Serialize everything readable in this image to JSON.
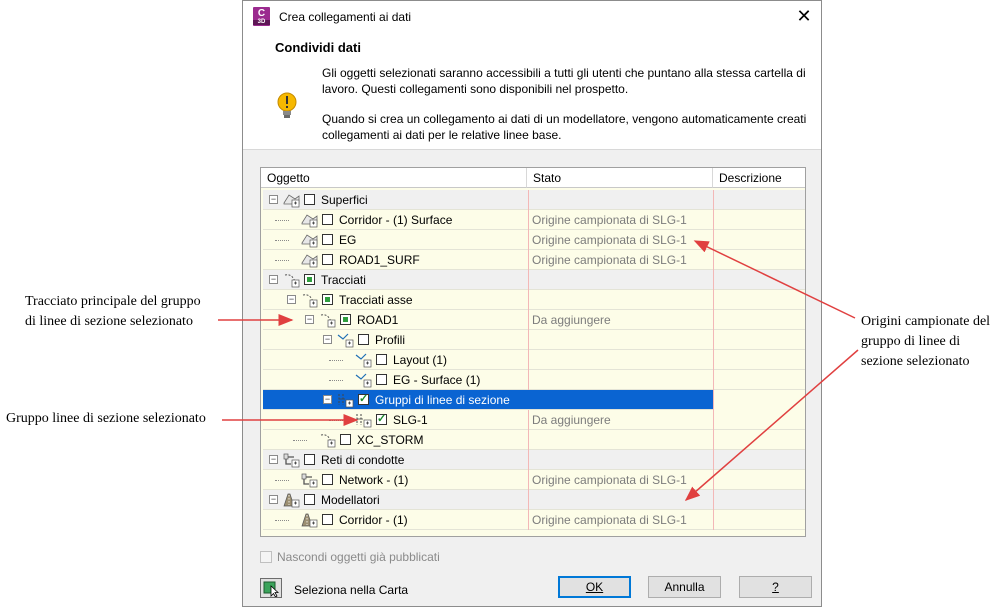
{
  "window": {
    "title": "Crea collegamenti ai dati",
    "app_icon_letter": "C",
    "app_icon_sub": "3D",
    "close_glyph": "✕"
  },
  "header": {
    "title": "Condividi dati",
    "paragraph1": "Gli oggetti selezionati saranno accessibili a tutti gli utenti che puntano alla stessa cartella di lavoro. Questi collegamenti sono disponibili nel prospetto.",
    "paragraph2": "Quando si crea un collegamento ai dati di un modellatore, vengono automaticamente creati collegamenti ai dati per le relative linee base.",
    "icon": "lightbulb-icon"
  },
  "columns": {
    "object": "Oggetto",
    "state": "Stato",
    "description": "Descrizione"
  },
  "tree": {
    "rows": [
      {
        "label": "Superfici",
        "state": "",
        "icon": "surface-icon",
        "check": "none",
        "expander": "−"
      },
      {
        "label": "Corridor - (1) Surface",
        "state": "Origine campionata di SLG-1",
        "icon": "surface-icon",
        "check": "none"
      },
      {
        "label": "EG",
        "state": "Origine campionata di SLG-1",
        "icon": "surface-icon",
        "check": "none"
      },
      {
        "label": "ROAD1_SURF",
        "state": "Origine campionata di SLG-1",
        "icon": "surface-icon",
        "check": "none"
      },
      {
        "label": "Tracciati",
        "state": "",
        "icon": "alignment-icon",
        "check": "partial",
        "expander": "−"
      },
      {
        "label": "Tracciati asse",
        "state": "",
        "icon": "alignment-icon",
        "check": "partial",
        "expander": "−"
      },
      {
        "label": "ROAD1",
        "state": "Da aggiungere",
        "icon": "alignment-icon",
        "check": "partial",
        "expander": "−"
      },
      {
        "label": "Profili",
        "state": "",
        "icon": "profile-icon",
        "check": "none",
        "expander": "−"
      },
      {
        "label": "Layout (1)",
        "state": "",
        "icon": "profile-icon",
        "check": "none"
      },
      {
        "label": "EG - Surface (1)",
        "state": "",
        "icon": "profile-icon",
        "check": "none"
      },
      {
        "label": "Gruppi di linee di sezione",
        "state": "",
        "icon": "sample-line-group-icon",
        "check": "checked",
        "expander": "−"
      },
      {
        "label": "SLG-1",
        "state": "Da aggiungere",
        "icon": "sample-line-group-icon",
        "check": "checked"
      },
      {
        "label": "XC_STORM",
        "state": "",
        "icon": "alignment-icon",
        "check": "none"
      },
      {
        "label": "Reti di condotte",
        "state": "",
        "icon": "pipe-network-icon",
        "check": "none",
        "expander": "−"
      },
      {
        "label": "Network - (1)",
        "state": "Origine campionata di SLG-1",
        "icon": "pipe-network-icon",
        "check": "none"
      },
      {
        "label": "Modellatori",
        "state": "",
        "icon": "corridor-icon",
        "check": "none",
        "expander": "−"
      },
      {
        "label": "Corridor - (1)",
        "state": "Origine campionata di SLG-1",
        "icon": "corridor-icon",
        "check": "none"
      }
    ]
  },
  "footer": {
    "hide_published": "Nascondi oggetti già pubblicati",
    "select_in_map": "Seleziona nella Carta",
    "ok_label": "OK",
    "cancel_label": "Annulla",
    "help_label": "?"
  },
  "callouts": {
    "main_alignment": [
      "Tracciato principale del gruppo",
      "di linee di sezione selezionato"
    ],
    "selected_group": "Gruppo linee di sezione selezionato",
    "sampled_sources": [
      "Origini campionate del",
      "gruppo di linee di",
      "sezione selezionato"
    ]
  },
  "colors": {
    "selection": "#0a64d2",
    "row_background": "#fdfde8",
    "arrow": "#e04040",
    "partial_check": "#2f9e3f"
  }
}
